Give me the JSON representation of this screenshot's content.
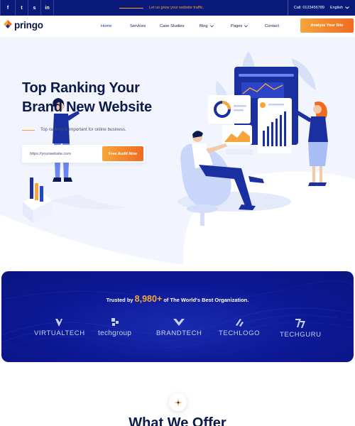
{
  "topbar": {
    "social": [
      "f",
      "t",
      "s",
      "in"
    ],
    "promo_text": "Let us grow your website traffic.",
    "phone": "Call: 0123456789",
    "language": "English"
  },
  "header": {
    "brand": "pringo",
    "nav": [
      {
        "label": "Home"
      },
      {
        "label": "Services"
      },
      {
        "label": "Case Studies"
      },
      {
        "label": "Blog"
      },
      {
        "label": "Pages"
      },
      {
        "label": "Contact"
      }
    ],
    "cta_label": "Analyze Your Site"
  },
  "hero": {
    "title_line1": "Top Ranking Your",
    "title_line2": "Brand New Website",
    "subtitle": "Top ranking is important for online business.",
    "input_placeholder": "https://yourwebsite.com",
    "button_label": "Free Audit Now"
  },
  "trusted": {
    "prefix": "Trusted by ",
    "count": "8,980+",
    "suffix": " of The World's Best Organization.",
    "brands": [
      "VIRTUALTECH",
      "techgroup",
      "BRANDTECH",
      "TECHLOGO",
      "TECHGURU"
    ]
  },
  "offer": {
    "title": "What We Offer"
  },
  "colors": {
    "navy": "#0a1a7a",
    "accent_orange": "#f4a23a",
    "text_dark": "#0b1a4a",
    "hero_bg": "#f2f5fd"
  }
}
